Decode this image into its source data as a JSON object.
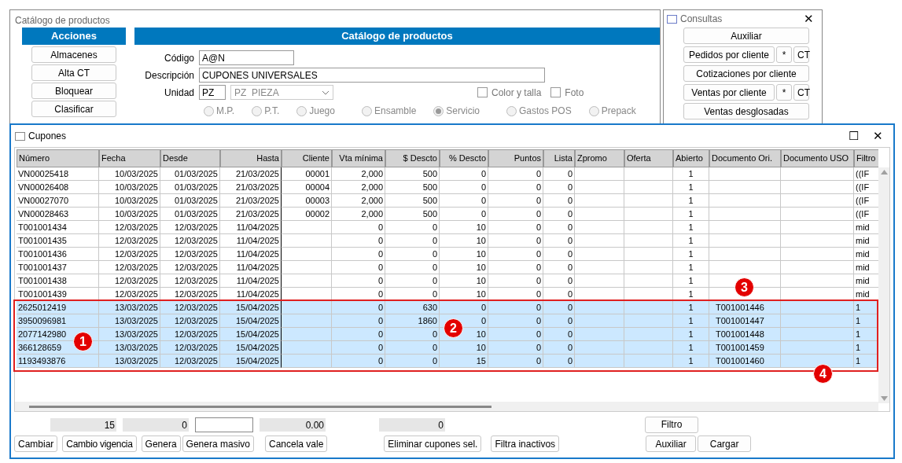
{
  "catalog_window": {
    "title": "Catálogo de productos",
    "actions_header": "Acciones",
    "actions": [
      "Almacenes",
      "Alta CT",
      "Bloquear",
      "Clasificar"
    ],
    "header": "Catálogo de productos",
    "fields": [
      {
        "label": "Código",
        "value": "A@N"
      },
      {
        "label": "Descripción",
        "value": "CUPONES UNIVERSALES"
      },
      {
        "label": "Unidad",
        "value": "PZ",
        "select": "PZ  PIEZA"
      }
    ],
    "checkboxes": [
      {
        "label": "Color y talla",
        "checked": false
      },
      {
        "label": "Foto",
        "checked": false
      }
    ],
    "radios": [
      {
        "label": "M.P.",
        "selected": false
      },
      {
        "label": "P.T.",
        "selected": false
      },
      {
        "label": "Juego",
        "selected": false
      },
      {
        "label": "Ensamble",
        "selected": false
      },
      {
        "label": "Servicio",
        "selected": true
      },
      {
        "label": "Gastos POS",
        "selected": false
      },
      {
        "label": "Prepack",
        "selected": false
      }
    ]
  },
  "consultas": {
    "title": "Consultas",
    "close": "✕",
    "buttons": [
      {
        "label": "Auxiliar"
      },
      {
        "label": "Pedidos por cliente",
        "extra": [
          "*",
          "CT"
        ]
      },
      {
        "label": "Cotizaciones por cliente"
      },
      {
        "label": "Ventas por cliente",
        "extra": [
          "*",
          "CT"
        ]
      },
      {
        "label": "Ventas desglosadas"
      }
    ]
  },
  "cupones": {
    "title": "Cupones",
    "maximize": "☐",
    "close": "✕",
    "columns": [
      "Número",
      "Fecha",
      "Desde",
      "Hasta",
      "Cliente",
      "Vta mínima",
      "$ Descto",
      "% Descto",
      "Puntos",
      "Lista",
      "Zpromo",
      "Oferta",
      "Abierto",
      "Documento Ori.",
      "Documento USO",
      "Filtro"
    ],
    "rows": [
      {
        "selected": false,
        "cells": [
          "VN00025418",
          "10/03/2025",
          "01/03/2025",
          "21/03/2025",
          "00001",
          "2,000",
          "500",
          "0",
          "0",
          "0",
          "",
          "",
          "1",
          "",
          "",
          "((IF"
        ]
      },
      {
        "selected": false,
        "cells": [
          "VN00026408",
          "10/03/2025",
          "01/03/2025",
          "21/03/2025",
          "00004",
          "2,000",
          "500",
          "0",
          "0",
          "0",
          "",
          "",
          "1",
          "",
          "",
          "((IF"
        ]
      },
      {
        "selected": false,
        "cells": [
          "VN00027070",
          "10/03/2025",
          "01/03/2025",
          "21/03/2025",
          "00003",
          "2,000",
          "500",
          "0",
          "0",
          "0",
          "",
          "",
          "1",
          "",
          "",
          "((IF"
        ]
      },
      {
        "selected": false,
        "cells": [
          "VN00028463",
          "10/03/2025",
          "01/03/2025",
          "21/03/2025",
          "00002",
          "2,000",
          "500",
          "0",
          "0",
          "0",
          "",
          "",
          "1",
          "",
          "",
          "((IF"
        ]
      },
      {
        "selected": false,
        "cells": [
          "T001001434",
          "12/03/2025",
          "12/03/2025",
          "11/04/2025",
          "",
          "0",
          "0",
          "10",
          "0",
          "0",
          "",
          "",
          "1",
          "",
          "",
          "mid"
        ]
      },
      {
        "selected": false,
        "cells": [
          "T001001435",
          "12/03/2025",
          "12/03/2025",
          "11/04/2025",
          "",
          "0",
          "0",
          "10",
          "0",
          "0",
          "",
          "",
          "1",
          "",
          "",
          "mid"
        ]
      },
      {
        "selected": false,
        "cells": [
          "T001001436",
          "12/03/2025",
          "12/03/2025",
          "11/04/2025",
          "",
          "0",
          "0",
          "10",
          "0",
          "0",
          "",
          "",
          "1",
          "",
          "",
          "mid"
        ]
      },
      {
        "selected": false,
        "cells": [
          "T001001437",
          "12/03/2025",
          "12/03/2025",
          "11/04/2025",
          "",
          "0",
          "0",
          "10",
          "0",
          "0",
          "",
          "",
          "1",
          "",
          "",
          "mid"
        ]
      },
      {
        "selected": false,
        "cells": [
          "T001001438",
          "12/03/2025",
          "12/03/2025",
          "11/04/2025",
          "",
          "0",
          "0",
          "10",
          "0",
          "0",
          "",
          "",
          "1",
          "",
          "",
          "mid"
        ]
      },
      {
        "selected": false,
        "cells": [
          "T001001439",
          "12/03/2025",
          "12/03/2025",
          "11/04/2025",
          "",
          "0",
          "0",
          "10",
          "0",
          "0",
          "",
          "",
          "1",
          "",
          "",
          "mid"
        ]
      },
      {
        "selected": true,
        "cells": [
          "2625012419",
          "13/03/2025",
          "12/03/2025",
          "15/04/2025",
          "",
          "0",
          "630",
          "0",
          "0",
          "0",
          "",
          "",
          "1",
          "T001001446",
          "",
          "1"
        ]
      },
      {
        "selected": true,
        "cells": [
          "3950096981",
          "13/03/2025",
          "12/03/2025",
          "15/04/2025",
          "",
          "0",
          "1860",
          "0",
          "0",
          "0",
          "",
          "",
          "1",
          "T001001447",
          "",
          "1"
        ]
      },
      {
        "selected": true,
        "cells": [
          "2077142980",
          "13/03/2025",
          "12/03/2025",
          "15/04/2025",
          "",
          "0",
          "0",
          "10",
          "0",
          "0",
          "",
          "",
          "1",
          "T001001448",
          "",
          "1"
        ]
      },
      {
        "selected": true,
        "cells": [
          "366128659",
          "13/03/2025",
          "12/03/2025",
          "15/04/2025",
          "",
          "0",
          "0",
          "10",
          "0",
          "0",
          "",
          "",
          "1",
          "T001001459",
          "",
          "1"
        ]
      },
      {
        "selected": true,
        "cells": [
          "1193493876",
          "13/03/2025",
          "12/03/2025",
          "15/04/2025",
          "",
          "0",
          "0",
          "15",
          "0",
          "0",
          "",
          "",
          "1",
          "T001001460",
          "",
          "1"
        ]
      }
    ],
    "callouts": [
      "1",
      "2",
      "3",
      "4"
    ],
    "totals": [
      {
        "kind": "total",
        "value": "15"
      },
      {
        "kind": "total",
        "value": "0"
      },
      {
        "kind": "input"
      },
      {
        "kind": "total",
        "value": "0.00"
      },
      {
        "kind": "total",
        "value": "0"
      }
    ],
    "filter_button": "Filtro",
    "buttons": [
      "Cambiar",
      "Cambio vigencia",
      "Genera",
      "Genera masivo",
      "Cancela vale",
      "Eliminar cupones sel.",
      "Filtra inactivos",
      "Auxiliar",
      "Cargar"
    ]
  }
}
